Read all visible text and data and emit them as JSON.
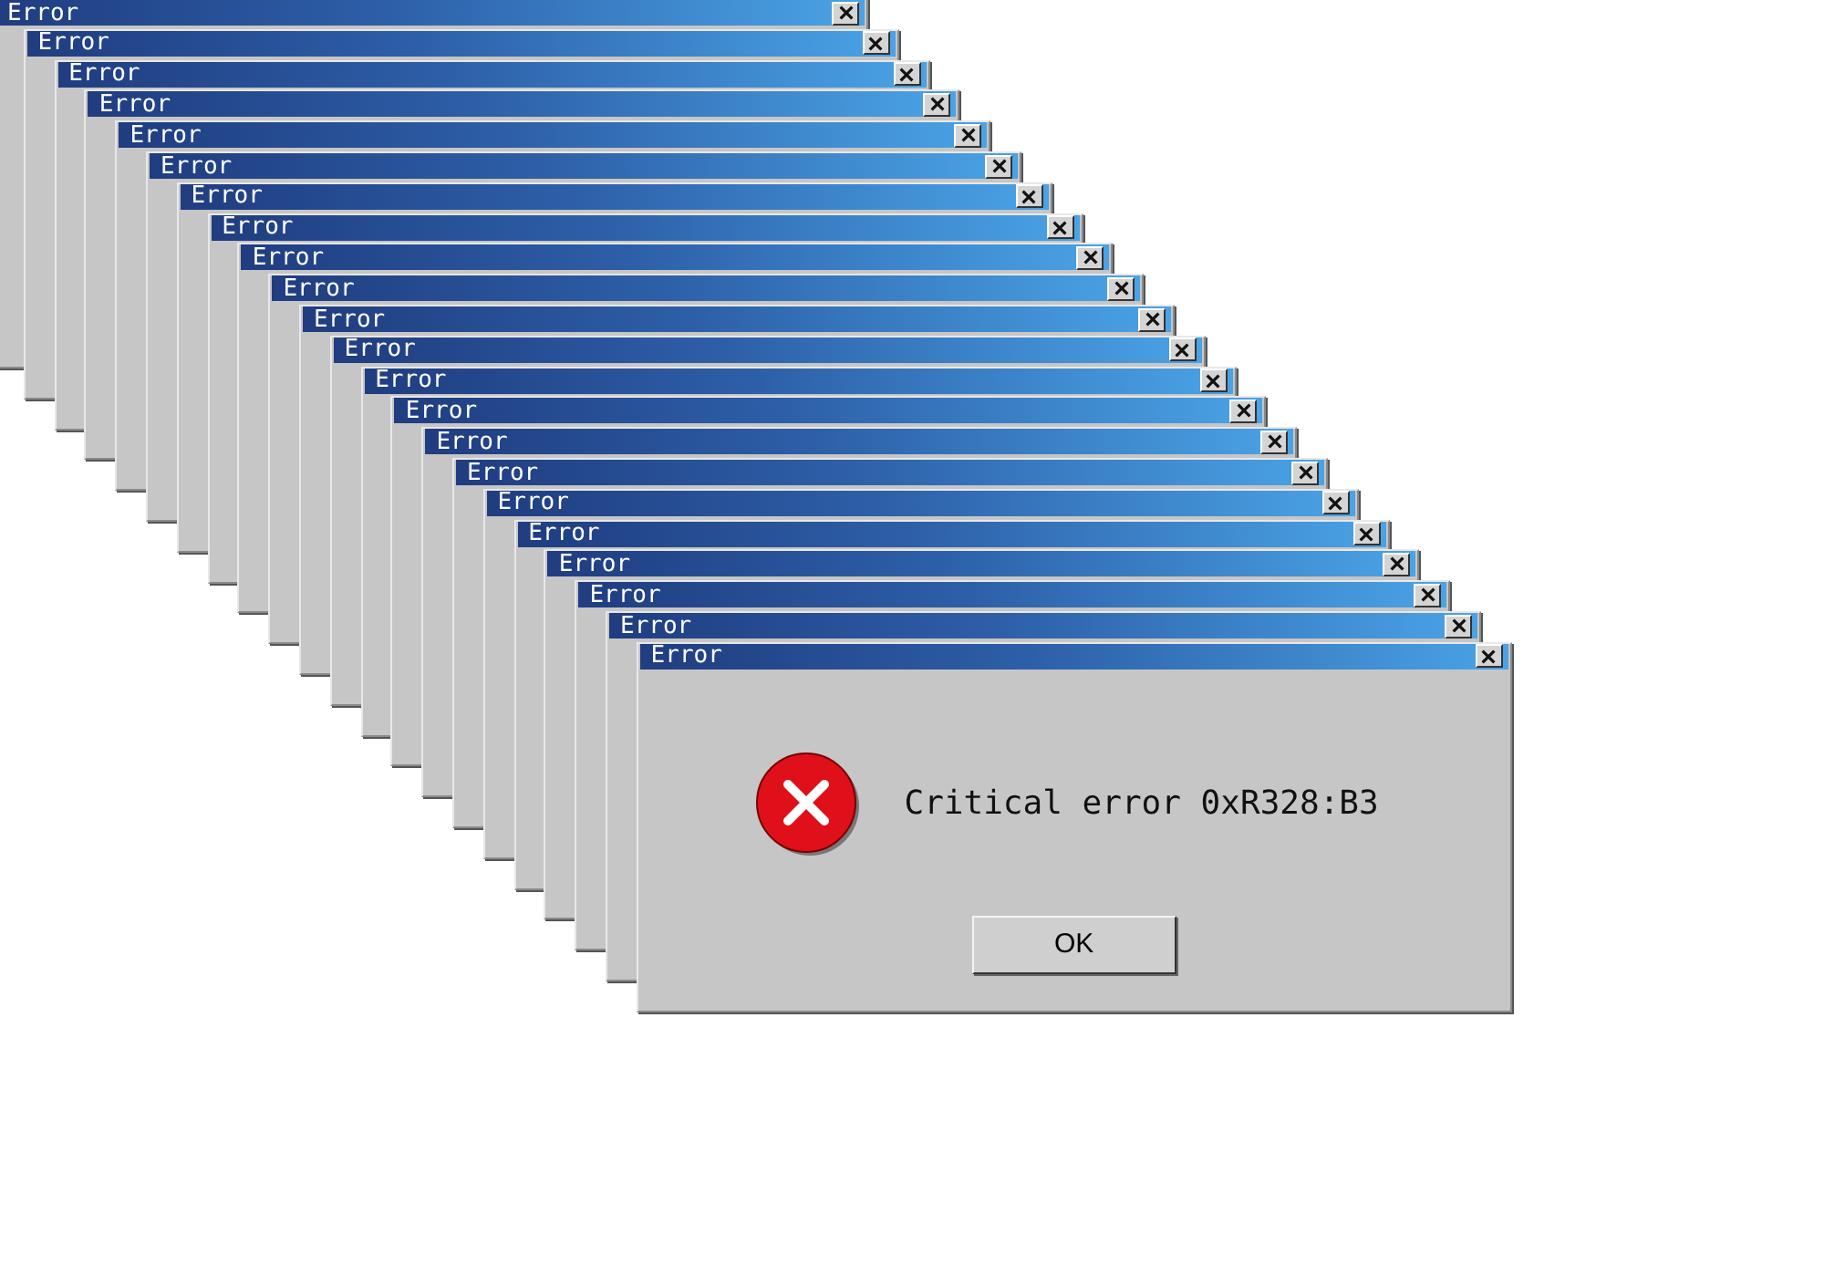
{
  "windows": [
    {
      "title": "Error"
    },
    {
      "title": "Error"
    },
    {
      "title": "Error"
    },
    {
      "title": "Error"
    },
    {
      "title": "Error"
    },
    {
      "title": "Error"
    },
    {
      "title": "Error"
    },
    {
      "title": "Error"
    },
    {
      "title": "Error"
    },
    {
      "title": "Error"
    },
    {
      "title": "Error"
    },
    {
      "title": "Error"
    },
    {
      "title": "Error"
    },
    {
      "title": "Error"
    },
    {
      "title": "Error"
    },
    {
      "title": "Error"
    },
    {
      "title": "Error"
    },
    {
      "title": "Error"
    },
    {
      "title": "Error"
    },
    {
      "title": "Error"
    },
    {
      "title": "Error"
    },
    {
      "title": "Error",
      "message": "Critical error 0xR328:B3",
      "button": "OK"
    }
  ]
}
